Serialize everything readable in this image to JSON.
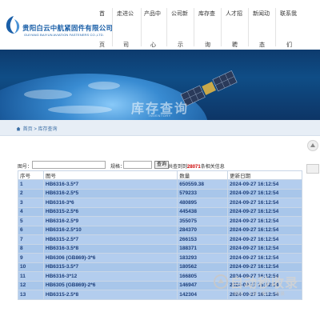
{
  "brand": {
    "name_cn": "贵阳白云中航紧固件有限公司",
    "name_en": "GUIYANG BAIYUN AVIATION FASTENERS CO.,LTD."
  },
  "nav": {
    "top": [
      "首",
      "走进公",
      "产品中",
      "公司新",
      "库存查",
      "人才招",
      "新闻动",
      "联系我"
    ],
    "bottom": [
      "页",
      "司",
      "心",
      "示",
      "询",
      "聘",
      "态",
      "们"
    ]
  },
  "banner": {
    "title": "库存查询",
    "subtitle": "INVENTORY"
  },
  "breadcrumb": {
    "home": "首页",
    "separator": ">",
    "current": "库存查询"
  },
  "search": {
    "model_label": "图号：",
    "model_value": "",
    "spec_label": "规格：",
    "spec_value": "",
    "query_button": "查询",
    "result_prefix": "共查到到",
    "result_count": "28071",
    "result_suffix": "条相关信息"
  },
  "table": {
    "headers": [
      "序号",
      "图号",
      "数量",
      "更新日期"
    ],
    "rows": [
      {
        "no": "1",
        "model": "HB6316-3.5*7",
        "qty": "650559.38",
        "date": "2024-09-27 16:12:54"
      },
      {
        "no": "2",
        "model": "HB6316-2.5*5",
        "qty": "579233",
        "date": "2024-09-27 16:12:54"
      },
      {
        "no": "3",
        "model": "HB6316-3*6",
        "qty": "480895",
        "date": "2024-09-27 16:12:54"
      },
      {
        "no": "4",
        "model": "HB6315-2.5*6",
        "qty": "445438",
        "date": "2024-09-27 16:12:54"
      },
      {
        "no": "5",
        "model": "HB6316-2.5*9",
        "qty": "355075",
        "date": "2024-09-27 16:12:54"
      },
      {
        "no": "6",
        "model": "HB6316-2.5*10",
        "qty": "284370",
        "date": "2024-09-27 16:12:54"
      },
      {
        "no": "7",
        "model": "HB6315-2.5*7",
        "qty": "266153",
        "date": "2024-09-27 16:12:54"
      },
      {
        "no": "8",
        "model": "HB6316-3.5*8",
        "qty": "188371",
        "date": "2024-09-27 16:12:54"
      },
      {
        "no": "9",
        "model": "HB6306 (GB869)-3*6",
        "qty": "183293",
        "date": "2024-09-27 16:12:54"
      },
      {
        "no": "10",
        "model": "HB6315-3.5*7",
        "qty": "180562",
        "date": "2024-09-27 16:12:54"
      },
      {
        "no": "11",
        "model": "HB6316-3*12",
        "qty": "166805",
        "date": "2024-09-27 16:12:54"
      },
      {
        "no": "12",
        "model": "HB6305 (GB869)-2*6",
        "qty": "146947",
        "date": "2024-09-27 16:12:54"
      },
      {
        "no": "13",
        "model": "HB6315-2.5*8",
        "qty": "142304",
        "date": "2024-09-27 16:12:54"
      }
    ]
  },
  "watermark": {
    "main": "自动秒收录",
    "sub": "网站 · 上线 · 推广 · 收录"
  },
  "colors": {
    "brand_blue": "#1a5fa8",
    "row_blue": "#a8c6ea",
    "result_red": "#cc0000"
  }
}
